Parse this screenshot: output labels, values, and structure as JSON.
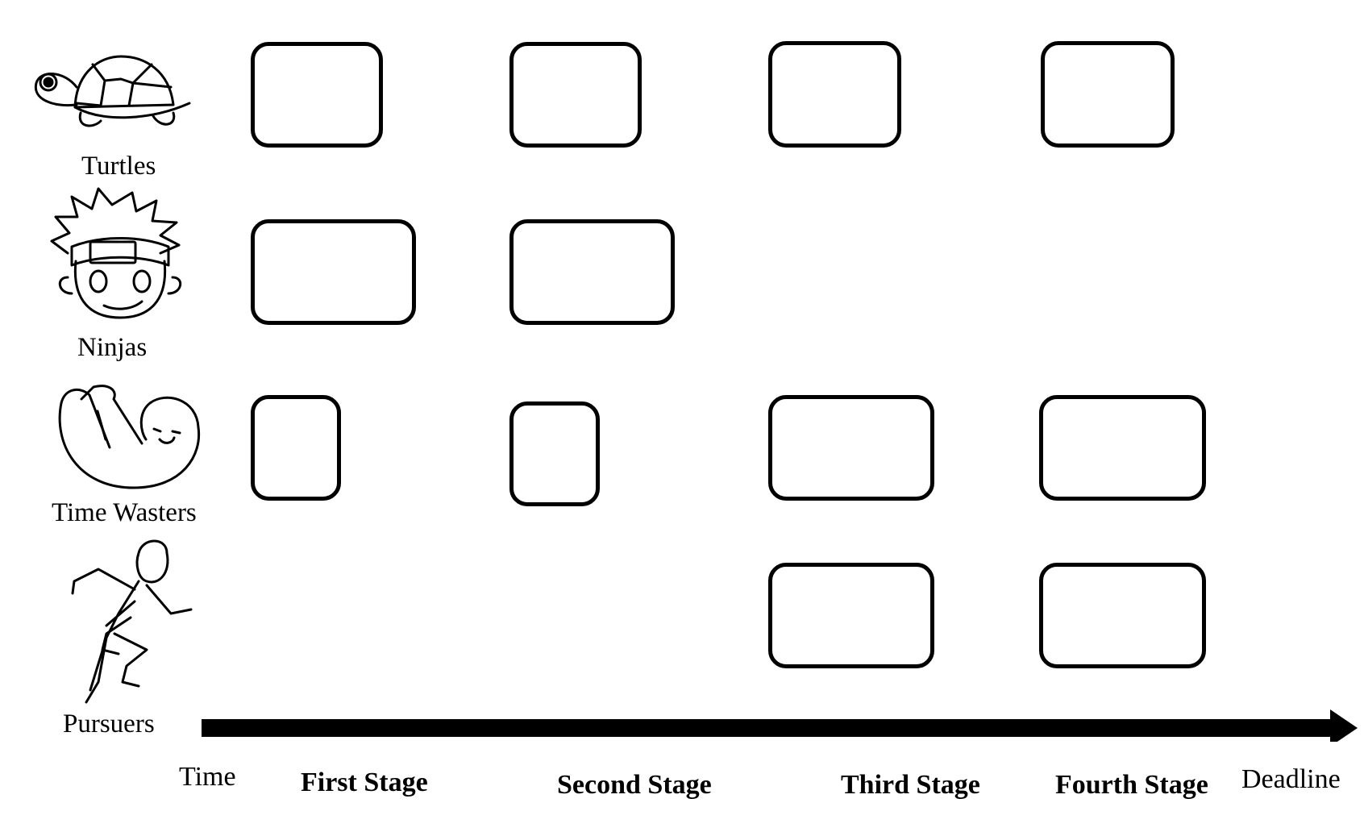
{
  "diagram": {
    "rows": [
      {
        "id": "turtles",
        "label": "Turtles",
        "icon": "turtle-icon",
        "active_stages": [
          1,
          2,
          3,
          4
        ]
      },
      {
        "id": "ninjas",
        "label": "Ninjas",
        "icon": "ninja-face-icon",
        "active_stages": [
          1,
          2
        ]
      },
      {
        "id": "time-wasters",
        "label": "Time Wasters",
        "icon": "sloth-icon",
        "active_stages": [
          1,
          2,
          3,
          4
        ]
      },
      {
        "id": "pursuers",
        "label": "Pursuers",
        "icon": "runner-icon",
        "active_stages": [
          3,
          4
        ]
      }
    ],
    "axis": {
      "start_label": "Time",
      "end_label": "Deadline",
      "stages": [
        "First Stage",
        "Second Stage",
        "Third Stage",
        "Fourth Stage"
      ],
      "color": "#000000"
    }
  }
}
